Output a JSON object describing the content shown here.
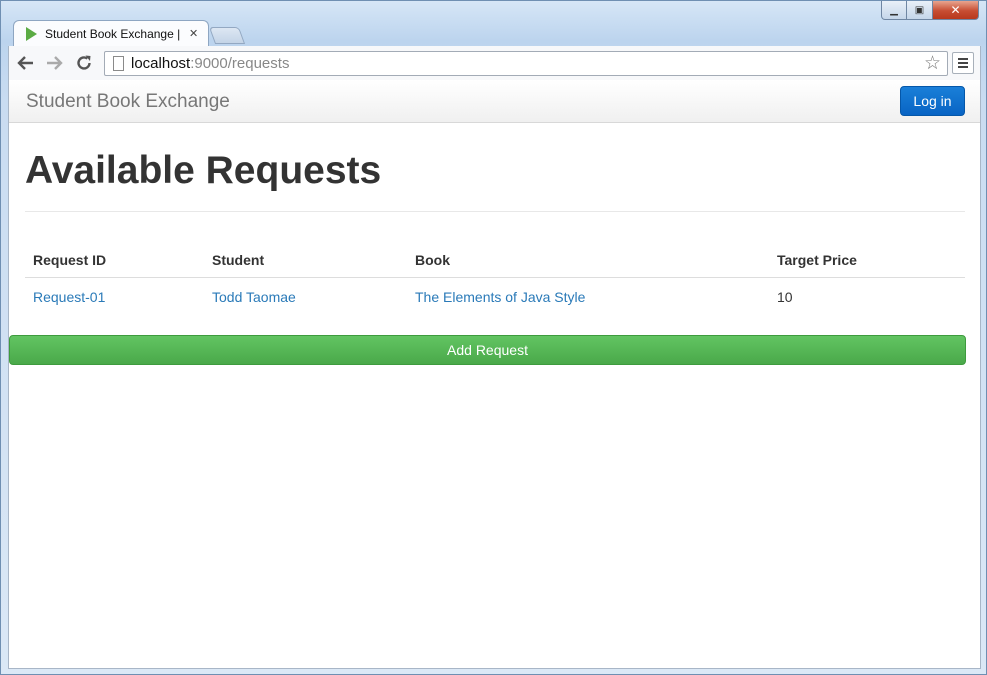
{
  "browser": {
    "tab_title": "Student Book Exchange | R",
    "tab_close": "✕",
    "url_host": "localhost",
    "url_path": ":9000/requests",
    "win_min": "▁",
    "win_max": "▣",
    "win_close": "✕"
  },
  "navbar": {
    "brand": "Student Book Exchange",
    "login_label": "Log in"
  },
  "main": {
    "title": "Available Requests",
    "table": {
      "headers": [
        "Request ID",
        "Student",
        "Book",
        "Target Price"
      ],
      "rows": [
        [
          "Request-01",
          "Todd Taomae",
          "The Elements of Java Style",
          "10"
        ]
      ]
    },
    "add_label": "Add Request"
  },
  "colors": {
    "primary": "#0864c4",
    "success": "#5cb85c",
    "link": "#2a7ab8"
  },
  "icons": [
    "back-arrow-icon",
    "forward-arrow-icon",
    "reload-icon",
    "page-icon",
    "star-icon",
    "menu-icon",
    "play-favicon-icon"
  ]
}
